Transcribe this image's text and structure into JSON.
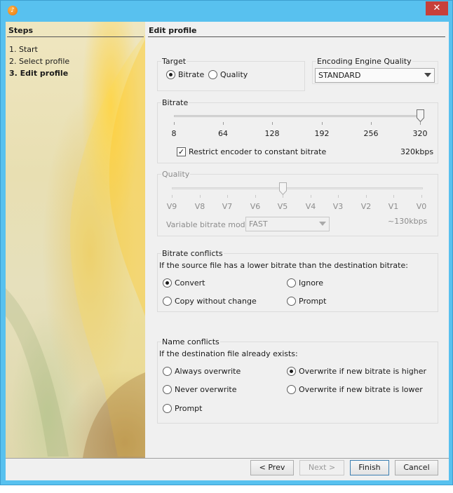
{
  "window": {
    "icon": "music-note-icon",
    "close_label": "✕"
  },
  "steps": {
    "header": "Steps",
    "items": [
      "1. Start",
      "2. Select profile",
      "3. Edit profile"
    ]
  },
  "pane": {
    "title": "Edit profile"
  },
  "target": {
    "label": "Target",
    "options": [
      "Bitrate",
      "Quality"
    ],
    "selected": "Bitrate"
  },
  "engine": {
    "label": "Encoding Engine Quality",
    "selected": "STANDARD"
  },
  "bitrate": {
    "label": "Bitrate",
    "ticks": [
      "8",
      "64",
      "128",
      "192",
      "256",
      "320"
    ],
    "value": 320,
    "restrict_label": "Restrict encoder to constant bitrate",
    "restrict_checked": true,
    "readout": "320kbps"
  },
  "quality": {
    "label": "Quality",
    "ticks": [
      "V9",
      "V8",
      "V7",
      "V6",
      "V5",
      "V4",
      "V3",
      "V2",
      "V1",
      "V0"
    ],
    "value": "V5",
    "vbr_label": "Variable bitrate mode",
    "vbr_selected": "FAST",
    "readout": "~130kbps"
  },
  "bitrate_conflicts": {
    "label": "Bitrate conflicts",
    "description": "If the source file has a lower bitrate than the destination bitrate:",
    "options": [
      "Convert",
      "Ignore",
      "Copy without change",
      "Prompt"
    ],
    "selected": "Convert"
  },
  "name_conflicts": {
    "label": "Name conflicts",
    "description": "If the destination file already exists:",
    "options": [
      "Always overwrite",
      "Overwrite if new bitrate is higher",
      "Never overwrite",
      "Overwrite if new bitrate is lower",
      "Prompt"
    ],
    "selected": "Overwrite if new bitrate is higher"
  },
  "buttons": {
    "prev": "< Prev",
    "next": "Next >",
    "finish": "Finish",
    "cancel": "Cancel"
  }
}
